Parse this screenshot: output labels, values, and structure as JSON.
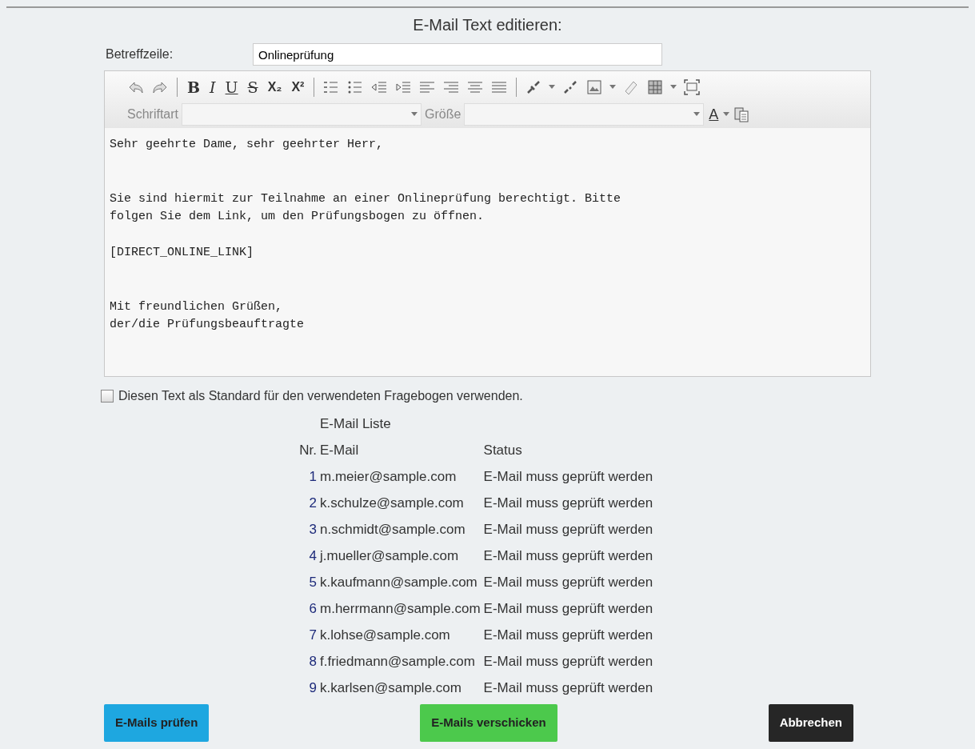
{
  "title": "E-Mail Text editieren:",
  "subject": {
    "label": "Betreffzeile:",
    "value": "Onlineprüfung"
  },
  "editor": {
    "format_buttons": [
      "B",
      "I",
      "U",
      "S",
      "X₂",
      "X²"
    ],
    "font_label": "Schriftart",
    "size_label": "Größe",
    "font_color_label": "A",
    "text": "Sehr geehrte Dame, sehr geehrter Herr,\n\n\nSie sind hiermit zur Teilnahme an einer Onlineprüfung berechtigt. Bitte\nfolgen Sie dem Link, um den Prüfungsbogen zu öffnen.\n\n[DIRECT_ONLINE_LINK]\n\n\nMit freundlichen Grüßen,\nder/die Prüfungsbeauftragte"
  },
  "default_checkbox": {
    "label": "Diesen Text als Standard für den verwendeten Fragebogen verwenden.",
    "checked": false
  },
  "email_list": {
    "title": "E-Mail Liste",
    "columns": [
      "Nr.",
      "E-Mail",
      "Status"
    ],
    "rows": [
      {
        "nr": "1",
        "email": "m.meier@sample.com",
        "status": "E-Mail muss geprüft werden"
      },
      {
        "nr": "2",
        "email": "k.schulze@sample.com",
        "status": "E-Mail muss geprüft werden"
      },
      {
        "nr": "3",
        "email": "n.schmidt@sample.com",
        "status": "E-Mail muss geprüft werden"
      },
      {
        "nr": "4",
        "email": "j.mueller@sample.com",
        "status": "E-Mail muss geprüft werden"
      },
      {
        "nr": "5",
        "email": "k.kaufmann@sample.com",
        "status": "E-Mail muss geprüft werden"
      },
      {
        "nr": "6",
        "email": "m.herrmann@sample.com",
        "status": "E-Mail muss geprüft werden"
      },
      {
        "nr": "7",
        "email": "k.lohse@sample.com",
        "status": "E-Mail muss geprüft werden"
      },
      {
        "nr": "8",
        "email": "f.friedmann@sample.com",
        "status": "E-Mail muss geprüft werden"
      },
      {
        "nr": "9",
        "email": "k.karlsen@sample.com",
        "status": "E-Mail muss geprüft werden"
      }
    ]
  },
  "buttons": [
    {
      "label": "E-Mails prüfen",
      "kind": "check"
    },
    {
      "label": "E-Mails verschicken",
      "kind": "send"
    },
    {
      "label": "Abbrechen",
      "kind": "cancel"
    }
  ]
}
